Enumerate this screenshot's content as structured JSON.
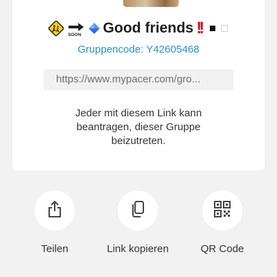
{
  "group": {
    "name": "Good friends",
    "emoji_prefix": [
      "children-crossing-sign",
      "soon-arrow",
      "blue-diamond"
    ],
    "emoji_suffix": [
      "double-exclamation",
      "black-square",
      "white-square"
    ],
    "code_label": "Gruppencode: Y42605468",
    "invite_link": "https://www.mypacer.com/gro...",
    "description": "Jeder mit diesem Link kann beantragen, dieser Gruppe beizutreten."
  },
  "actions": [
    {
      "label": "Teilen",
      "icon": "share-icon"
    },
    {
      "label": "Link kopieren",
      "icon": "copy-icon"
    },
    {
      "label": "QR Code",
      "icon": "qr-code-icon"
    }
  ],
  "colors": {
    "background": "#f2f2f2",
    "card": "#ffffff",
    "accent": "#2a8fce",
    "link_box": "#f1f1f1"
  }
}
